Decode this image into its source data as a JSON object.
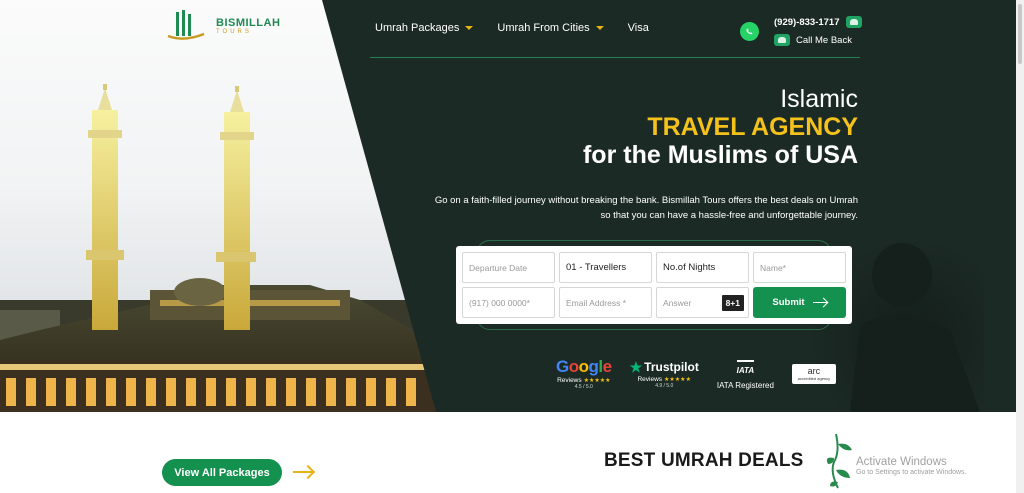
{
  "brand": {
    "name": "BISMILLAH",
    "sub": "TOURS"
  },
  "nav": [
    {
      "label": "Umrah Packages",
      "dropdown": true
    },
    {
      "label": "Umrah From Cities",
      "dropdown": true
    },
    {
      "label": "Visa",
      "dropdown": false
    }
  ],
  "contact": {
    "phone": "(929)-833-1717",
    "callback": "Call Me Back"
  },
  "hero": {
    "line1": "Islamic",
    "line2": "TRAVEL AGENCY",
    "line3": "for the Muslims of USA",
    "intro": "Go on a faith-filled journey without breaking the bank. Bismillah Tours offers the best deals on Umrah so that you can have a hassle-free and unforgettable journey."
  },
  "form": {
    "departure_placeholder": "Departure Date",
    "travellers_value": "01 - Travellers",
    "nights_value": "No.of Nights",
    "name_placeholder": "Name*",
    "phone_placeholder": "(917) 000 0000*",
    "email_placeholder": "Email Address *",
    "answer_placeholder": "Answer",
    "captcha": "8+1",
    "submit_label": "Submit"
  },
  "badges": {
    "google_letters": [
      "G",
      "o",
      "o",
      "g",
      "l",
      "e"
    ],
    "google_sub": "Reviews",
    "google_score": "4.5 / 5.0",
    "trustpilot_name": "Trustpilot",
    "trustpilot_sub": "Reviews",
    "trustpilot_score": "4.9 / 5.0",
    "iata_logo": "IATA",
    "iata_text": "IATA Registered",
    "arc_name": "arc",
    "arc_sub": "accredited agency"
  },
  "bottom": {
    "view_all": "View All Packages",
    "deals_title": "BEST UMRAH DEALS"
  },
  "windows_notice": {
    "title": "Activate Windows",
    "subtitle": "Go to Settings to activate Windows."
  },
  "colors": {
    "brand_green": "#14904f",
    "accent_gold": "#f4c21a",
    "panel_dark": "#1c2a25"
  }
}
